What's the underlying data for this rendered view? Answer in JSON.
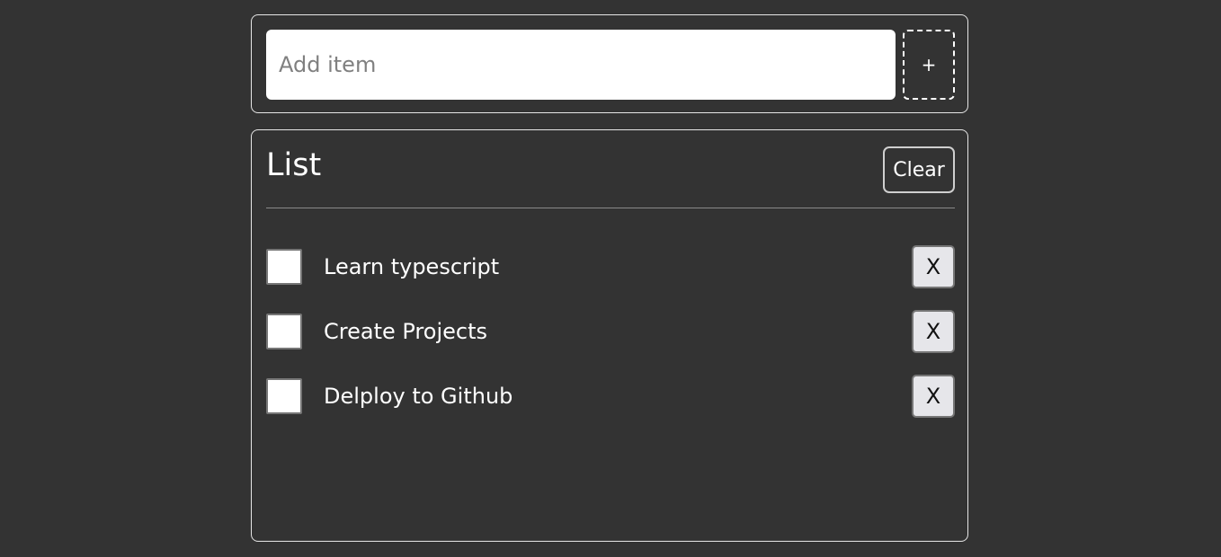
{
  "add_form": {
    "placeholder": "Add item",
    "value": "",
    "add_label": "+"
  },
  "list": {
    "title": "List",
    "clear_label": "Clear",
    "remove_label": "X",
    "items": [
      {
        "label": "Learn typescript",
        "checked": false
      },
      {
        "label": "Create Projects",
        "checked": false
      },
      {
        "label": "Delploy to Github",
        "checked": false
      }
    ]
  },
  "colors": {
    "background": "#333333",
    "border": "#e6e6e6",
    "text": "#ffffff"
  }
}
